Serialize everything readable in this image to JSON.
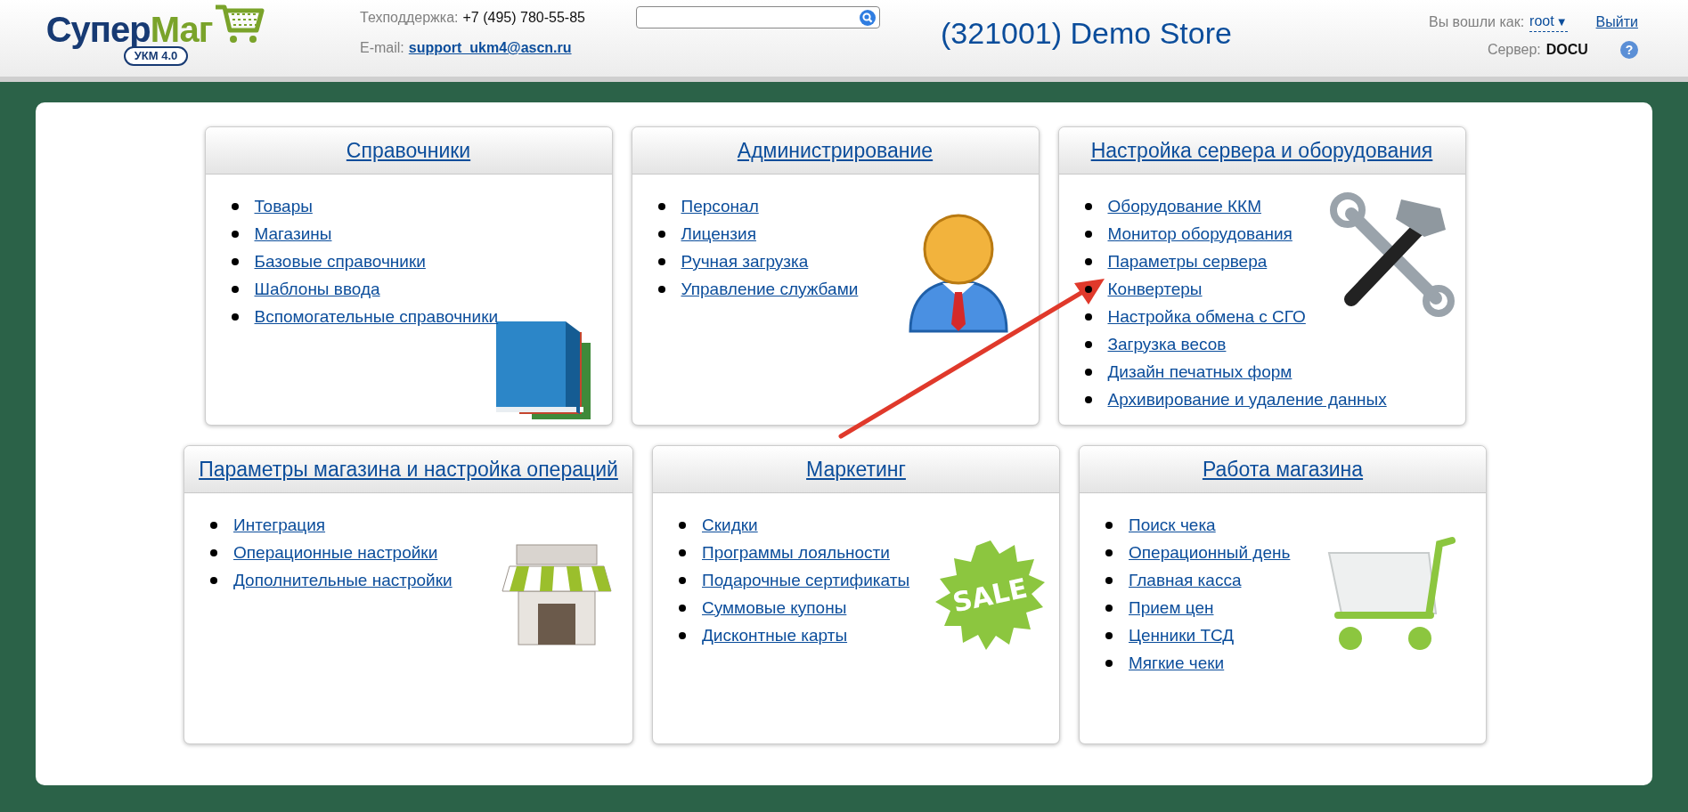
{
  "header": {
    "logo": {
      "brand_primary": "Супер",
      "brand_secondary": "Маг",
      "badge": "УКМ 4.0"
    },
    "support": {
      "label": "Техподдержка:",
      "phone": "+7 (495) 780-55-85"
    },
    "email": {
      "label": "E-mail:",
      "address": "support_ukm4@ascn.ru"
    },
    "store_title": "(321001) Demo Store",
    "user": {
      "label": "Вы вошли как:",
      "name": "root",
      "menu_glyph": "▼"
    },
    "logout": "Выйти",
    "server": {
      "label": "Сервер:",
      "value": "DOCU"
    },
    "help": "?"
  },
  "rows": [
    {
      "sections": [
        {
          "title": "Справочники",
          "kind": "books",
          "links": [
            "Товары",
            "Магазины",
            "Базовые справочники",
            "Шаблоны ввода",
            "Вспомогательные справочники"
          ]
        },
        {
          "title": "Администрирование",
          "kind": "person",
          "links": [
            "Персонал",
            "Лицензия",
            "Ручная загрузка",
            "Управление службами"
          ]
        },
        {
          "title": "Настройка сервера и оборудования",
          "kind": "tools",
          "links": [
            "Оборудование ККМ",
            "Монитор оборудования",
            "Параметры сервера",
            "Конвертеры",
            "Настройка обмена с СГО",
            "Загрузка весов",
            "Дизайн печатных форм",
            "Архивирование и удаление данных"
          ]
        }
      ]
    },
    {
      "sections": [
        {
          "title": "Параметры магазина и настройка операций",
          "kind": "shop",
          "links": [
            "Интеграция",
            "Операционные настройки",
            "Дополнительные настройки"
          ]
        },
        {
          "title": "Маркетинг",
          "kind": "sale",
          "icon_text": "SALE",
          "links": [
            "Скидки",
            "Программы лояльности",
            "Подарочные сертификаты",
            "Суммовые купоны",
            "Дисконтные карты"
          ]
        },
        {
          "title": "Работа магазина",
          "kind": "cart",
          "links": [
            "Поиск чека",
            "Операционный день",
            "Главная касса",
            "Прием цен",
            "Ценники ТСД",
            "Мягкие чеки"
          ]
        }
      ]
    }
  ],
  "annotations": [
    {
      "kind": "arrow"
    }
  ]
}
